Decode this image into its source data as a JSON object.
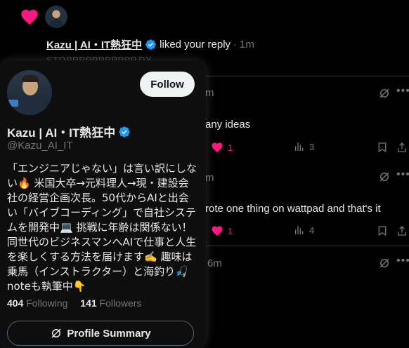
{
  "notification": {
    "user_name": "Kazu | AI・IT熱狂中",
    "action_text": "liked your reply",
    "separator": "·",
    "time": "1m",
    "faded_text": "STOPPPPPPPPPPP.DY"
  },
  "feed_rows": [
    {
      "time_fragment": "m",
      "text": "any ideas",
      "likes": "1",
      "views": "3"
    },
    {
      "time_fragment": "m",
      "text": "rote one thing on wattpad and that's it",
      "likes": "1",
      "views": "4"
    },
    {
      "time_fragment": "6m"
    }
  ],
  "hover_card": {
    "follow_label": "Follow",
    "name": "Kazu | AI・IT熱狂中",
    "handle": "@Kazu_AI_IT",
    "bio": "「エンジニアじゃない」は言い訳にしない🔥 米国大卒→元料理人→現・建設会社の経営企画次長。50代からAIと出会い「バイブコーディング」で自社システムを開発中💻 挑戦に年齢は関係ない！同世代のビジネスマンへAIで仕事と人生を楽しくする方法を届けます✍️ 趣味は乗馬（インストラクター）と海釣り🎣 noteも執筆中👇",
    "following_count": "404",
    "following_label": "Following",
    "followers_count": "141",
    "followers_label": "Followers",
    "profile_summary_label": "Profile Summary"
  },
  "colors": {
    "like_pink": "#f91880",
    "verified_blue": "#1d9bf0",
    "muted": "#71767b"
  }
}
